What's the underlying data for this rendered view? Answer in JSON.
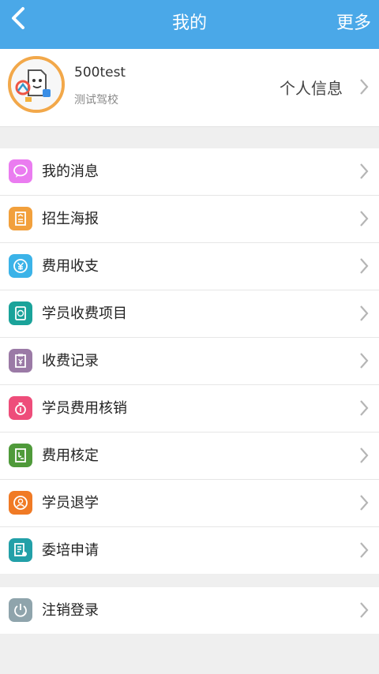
{
  "header": {
    "title": "我的",
    "more_label": "更多"
  },
  "profile": {
    "username": "500test",
    "school": "测试驾校",
    "info_label": "个人信息"
  },
  "menu": [
    {
      "label": "我的消息",
      "icon": "message-icon",
      "color": "#ea7cf0"
    },
    {
      "label": "招生海报",
      "icon": "poster-icon",
      "color": "#f2a03c"
    },
    {
      "label": "费用收支",
      "icon": "yuan-circle-icon",
      "color": "#3bb3e8"
    },
    {
      "label": "学员收费项目",
      "icon": "fee-item-icon",
      "color": "#1aa39a"
    },
    {
      "label": "收费记录",
      "icon": "clipboard-yuan-icon",
      "color": "#9b7aa6"
    },
    {
      "label": "学员费用核销",
      "icon": "money-bag-icon",
      "color": "#ee4d7a"
    },
    {
      "label": "费用核定",
      "icon": "document-check-icon",
      "color": "#4f9a3a"
    },
    {
      "label": "学员退学",
      "icon": "user-exit-icon",
      "color": "#f07a25"
    },
    {
      "label": "委培申请",
      "icon": "apply-form-icon",
      "color": "#22a0a8"
    }
  ],
  "logout": {
    "label": "注销登录",
    "icon": "power-icon",
    "color": "#8fa4ac"
  },
  "colors": {
    "header": "#4aa8e8",
    "background": "#efefef",
    "avatar_border": "#f2a84a"
  }
}
